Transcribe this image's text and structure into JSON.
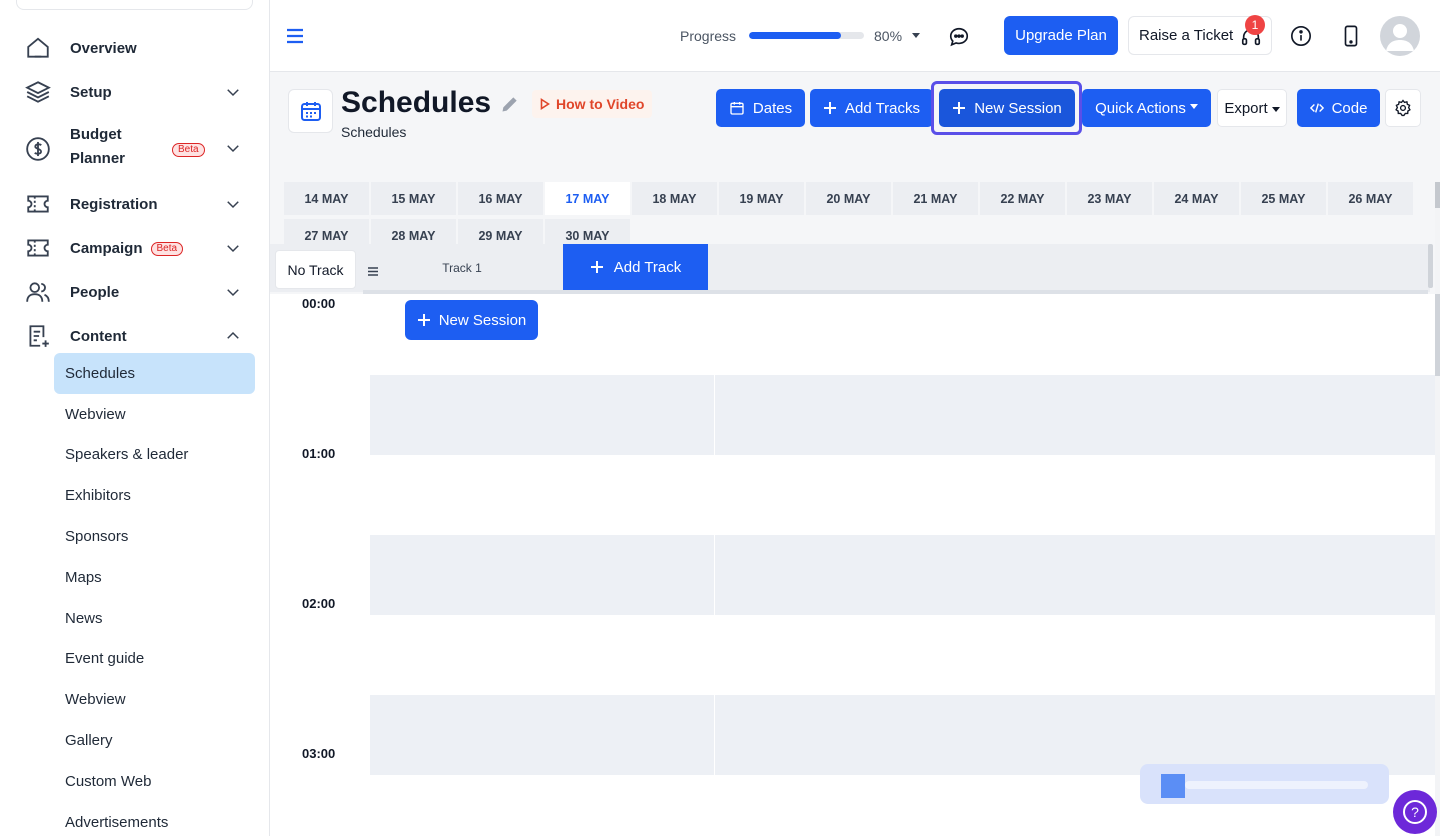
{
  "sidebar": {
    "nav": [
      {
        "label": "Overview",
        "icon": "home-icon"
      },
      {
        "label": "Setup",
        "icon": "layers-icon"
      },
      {
        "label": "Budget",
        "label2": "Planner",
        "badge": "Beta",
        "icon": "dollar-circle-icon"
      },
      {
        "label": "Registration",
        "icon": "ticket-icon"
      },
      {
        "label": "Campaign",
        "badge": "Beta",
        "icon": "ticket-icon"
      },
      {
        "label": "People",
        "icon": "people-icon"
      },
      {
        "label": "Content",
        "icon": "content-icon"
      }
    ],
    "content_items": [
      "Schedules",
      "Webview",
      "Speakers & leader",
      "Exhibitors",
      "Sponsors",
      "Maps",
      "News",
      "Event guide",
      "Webview",
      "Gallery",
      "Custom Web",
      "Advertisements"
    ],
    "active_item": "Schedules"
  },
  "topbar": {
    "progress_label": "Progress",
    "progress_value": 80,
    "progress_text": "80%",
    "upgrade_label": "Upgrade Plan",
    "ticket_label": "Raise a Ticket",
    "ticket_badge": "1"
  },
  "header": {
    "title": "Schedules",
    "subtitle": "Schedules",
    "how_to": "How to Video",
    "buttons": {
      "dates": "Dates",
      "add_tracks": "Add Tracks",
      "new_session": "New Session",
      "quick_actions": "Quick Actions",
      "export": "Export",
      "code": "Code"
    }
  },
  "dates": [
    "14 MAY",
    "15 MAY",
    "16 MAY",
    "17 MAY",
    "18 MAY",
    "19 MAY",
    "20 MAY",
    "21 MAY",
    "22 MAY",
    "23 MAY",
    "24 MAY",
    "25 MAY",
    "26 MAY",
    "27 MAY",
    "28 MAY",
    "29 MAY",
    "30 MAY"
  ],
  "active_date": "17 MAY",
  "tracks": {
    "no_track": "No Track",
    "track1": "Track 1",
    "add_track": "Add Track"
  },
  "timeline": {
    "new_session": "New Session",
    "times": [
      "00:00",
      "01:00",
      "02:00",
      "03:00"
    ]
  },
  "colors": {
    "primary": "#1d5ef2",
    "active_nav": "#c7e3fb",
    "focus_ring": "#5a4fe8",
    "badge_red": "#ef4444"
  }
}
